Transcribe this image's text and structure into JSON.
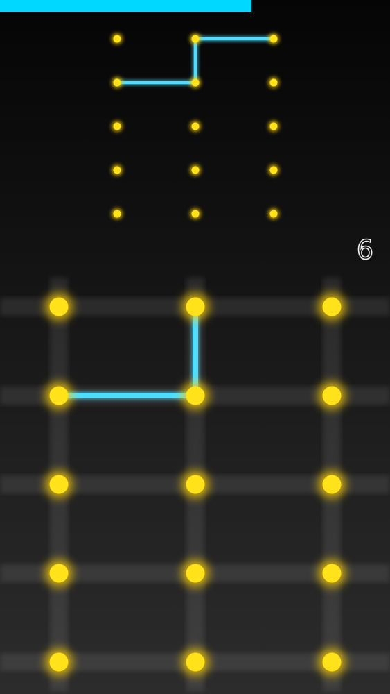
{
  "progress": {
    "fraction": 0.645,
    "color": "#00d8ff"
  },
  "move_count": "6",
  "colors": {
    "dot": "#ffe21a",
    "dot_glow": "#ffd000",
    "path": "#4fdcff",
    "grid_lane": "#ffffff"
  },
  "target_pattern": {
    "columns": 3,
    "rows": 5,
    "path": [
      [
        0,
        1
      ],
      [
        1,
        1
      ],
      [
        1,
        0
      ],
      [
        2,
        0
      ]
    ]
  },
  "play_board": {
    "columns": 3,
    "rows": 5,
    "path": [
      [
        0,
        1
      ],
      [
        1,
        1
      ],
      [
        1,
        0
      ]
    ]
  }
}
